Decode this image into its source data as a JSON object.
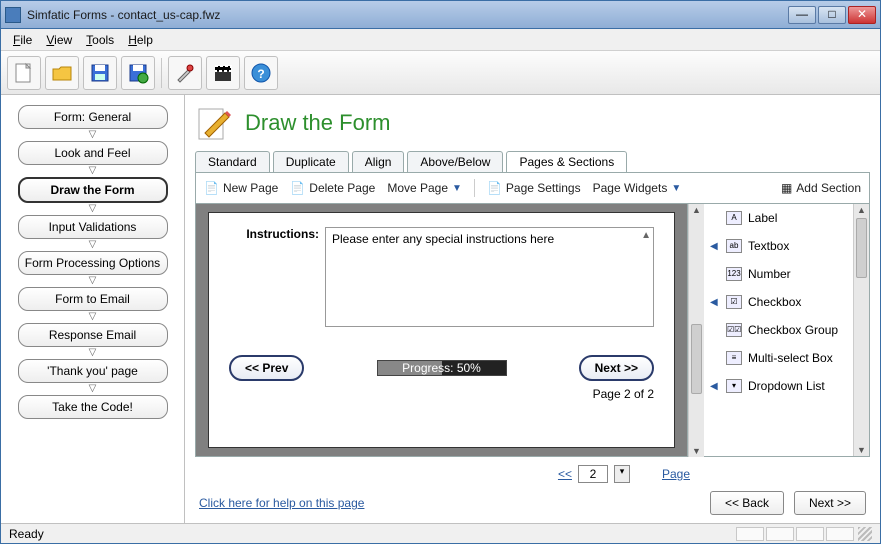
{
  "window": {
    "title": "Simfatic Forms - contact_us-cap.fwz"
  },
  "menu": {
    "file": "File",
    "view": "View",
    "tools": "Tools",
    "help": "Help"
  },
  "sidebar": {
    "steps": [
      "Form: General",
      "Look and Feel",
      "Draw the Form",
      "Input Validations",
      "Form Processing Options",
      "Form to Email",
      "Response Email",
      "'Thank you' page",
      "Take the Code!"
    ],
    "active_index": 2
  },
  "page": {
    "title": "Draw the Form"
  },
  "tabs": {
    "items": [
      "Standard",
      "Duplicate",
      "Align",
      "Above/Below",
      "Pages & Sections"
    ],
    "active_index": 4
  },
  "subtoolbar": {
    "newPage": "New Page",
    "deletePage": "Delete Page",
    "movePage": "Move Page",
    "pageSettings": "Page Settings",
    "pageWidgets": "Page Widgets",
    "addSection": "Add Section"
  },
  "form": {
    "instructions_label": "Instructions:",
    "instructions_value": "Please enter any special instructions here",
    "prev": "<< Prev",
    "next": "Next >>",
    "progress_text": "Progress: 50%",
    "progress_percent": 50,
    "page_info": "Page 2 of 2"
  },
  "pager": {
    "rewind": "<<",
    "value": "2",
    "link": "Page"
  },
  "palette": {
    "items": [
      {
        "label": "Label",
        "expandable": false
      },
      {
        "label": "Textbox",
        "expandable": true
      },
      {
        "label": "Number",
        "expandable": false
      },
      {
        "label": "Checkbox",
        "expandable": true
      },
      {
        "label": "Checkbox Group",
        "expandable": false
      },
      {
        "label": "Multi-select Box",
        "expandable": false
      },
      {
        "label": "Dropdown List",
        "expandable": true
      }
    ]
  },
  "footer": {
    "help_link": "Click here for help on this page",
    "back": "<< Back",
    "next": "Next >>"
  },
  "status": {
    "ready": "Ready"
  }
}
